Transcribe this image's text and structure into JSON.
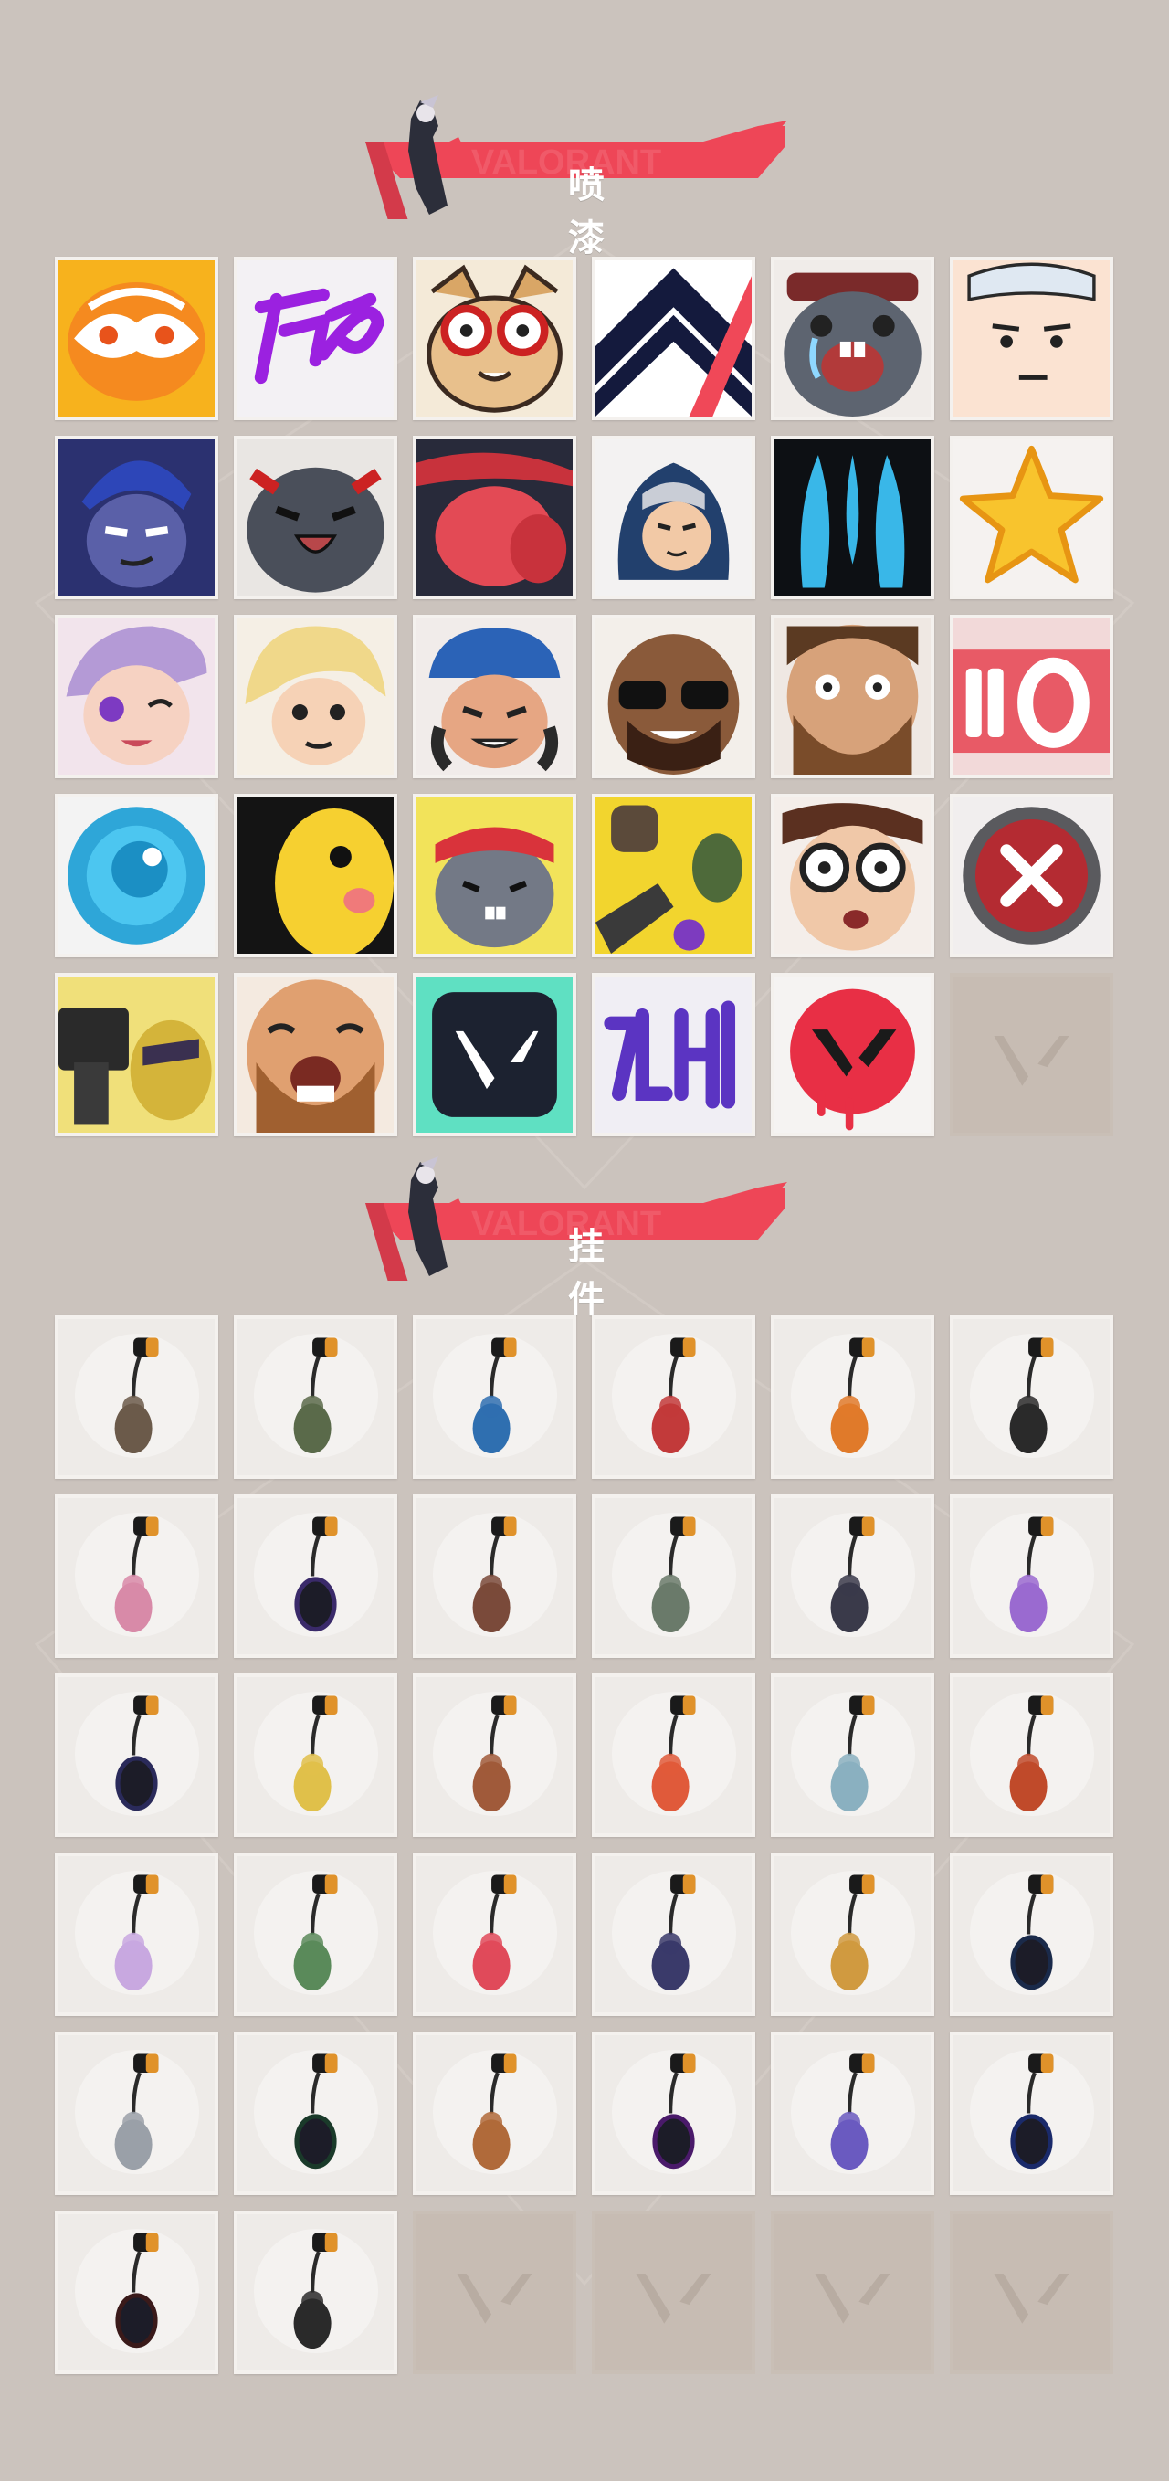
{
  "sections": {
    "sprays": {
      "title": "喷 漆",
      "watermark": "VALORANT",
      "items": [
        {
          "icon": "orange-mask-spray-icon"
        },
        {
          "icon": "purple-scribble-spray-icon"
        },
        {
          "icon": "goggles-cat-spray-icon"
        },
        {
          "icon": "chevron-logo-spray-icon"
        },
        {
          "icon": "crying-seal-spray-icon"
        },
        {
          "icon": "blank-face-spray-icon"
        },
        {
          "icon": "dark-agent-smirk-spray-icon"
        },
        {
          "icon": "grey-cat-laugh-spray-icon"
        },
        {
          "icon": "red-mouth-spray-icon"
        },
        {
          "icon": "hooded-agent-spray-icon"
        },
        {
          "icon": "blue-flame-spray-icon"
        },
        {
          "icon": "gold-star-spray-icon"
        },
        {
          "icon": "wink-agent-spray-icon"
        },
        {
          "icon": "blonde-agent-spray-icon"
        },
        {
          "icon": "cap-agent-spray-icon"
        },
        {
          "icon": "sunglasses-agent-spray-icon"
        },
        {
          "icon": "bearded-agent-spray-icon"
        },
        {
          "icon": "ammo-count-spray-icon"
        },
        {
          "icon": "blue-orb-spray-icon"
        },
        {
          "icon": "yellow-bird-spray-icon"
        },
        {
          "icon": "bandana-critter-spray-icon"
        },
        {
          "icon": "grenade-explosion-spray-icon"
        },
        {
          "icon": "glasses-agent-panic-spray-icon"
        },
        {
          "icon": "red-x-button-spray-icon"
        },
        {
          "icon": "pistol-character-spray-icon"
        },
        {
          "icon": "laughing-bearded-spray-icon"
        },
        {
          "icon": "valorant-logo-teal-spray-icon"
        },
        {
          "icon": "graffiti-tag-spray-icon"
        },
        {
          "icon": "red-v-drip-spray-icon"
        },
        {
          "icon": "empty-slot-icon",
          "empty": true
        }
      ]
    },
    "buddies": {
      "title": "挂 件",
      "watermark": "VALORANT",
      "items": [
        {
          "icon": "armored-critter-buddy-icon"
        },
        {
          "icon": "canteen-buddy-icon"
        },
        {
          "icon": "energy-drink-buddy-icon"
        },
        {
          "icon": "chainsaw-buddy-icon"
        },
        {
          "icon": "flame-creature-buddy-icon"
        },
        {
          "icon": "black-rope-buddy-icon"
        },
        {
          "icon": "cupcake-buddy-icon"
        },
        {
          "icon": "ep9-medal-buddy-icon"
        },
        {
          "icon": "agent-figure-buddy-icon"
        },
        {
          "icon": "cowboy-robot-buddy-icon"
        },
        {
          "icon": "dark-bat-buddy-icon"
        },
        {
          "icon": "lava-lamp-buddy-icon"
        },
        {
          "icon": "ep9-pink-medal-buddy-icon"
        },
        {
          "icon": "banana-creature-buddy-icon"
        },
        {
          "icon": "popsicle-buddy-icon"
        },
        {
          "icon": "skewer-buddy-icon"
        },
        {
          "icon": "agent-keychain-buddy-icon"
        },
        {
          "icon": "hot-air-balloon-buddy-icon"
        },
        {
          "icon": "crystal-cat-buddy-icon"
        },
        {
          "icon": "frankenstein-buddy-icon"
        },
        {
          "icon": "watermelon-buddy-icon"
        },
        {
          "icon": "lantern-buddy-icon"
        },
        {
          "icon": "beehive-buddy-icon"
        },
        {
          "icon": "ep9-gold-medal-buddy-icon"
        },
        {
          "icon": "silver-flame-buddy-icon"
        },
        {
          "icon": "ep8-green-medal-buddy-icon"
        },
        {
          "icon": "potion-bottle-buddy-icon"
        },
        {
          "icon": "ep8-purple-medal-buddy-icon"
        },
        {
          "icon": "ufo-buddy-icon"
        },
        {
          "icon": "ep8-blue-medal-buddy-icon"
        },
        {
          "icon": "ep7-orange-medal-buddy-icon"
        },
        {
          "icon": "valorant-v-buddy-icon"
        },
        {
          "icon": "empty-slot-icon",
          "empty": true
        },
        {
          "icon": "empty-slot-icon",
          "empty": true
        },
        {
          "icon": "empty-slot-icon",
          "empty": true
        },
        {
          "icon": "empty-slot-icon",
          "empty": true
        }
      ]
    }
  },
  "colors": {
    "background": "#cbc3bd",
    "banner_red": "#ee4657",
    "banner_dark": "#d33a4a",
    "tile_bg": "#ece8e4",
    "empty_tile": "#c7bcb3"
  }
}
